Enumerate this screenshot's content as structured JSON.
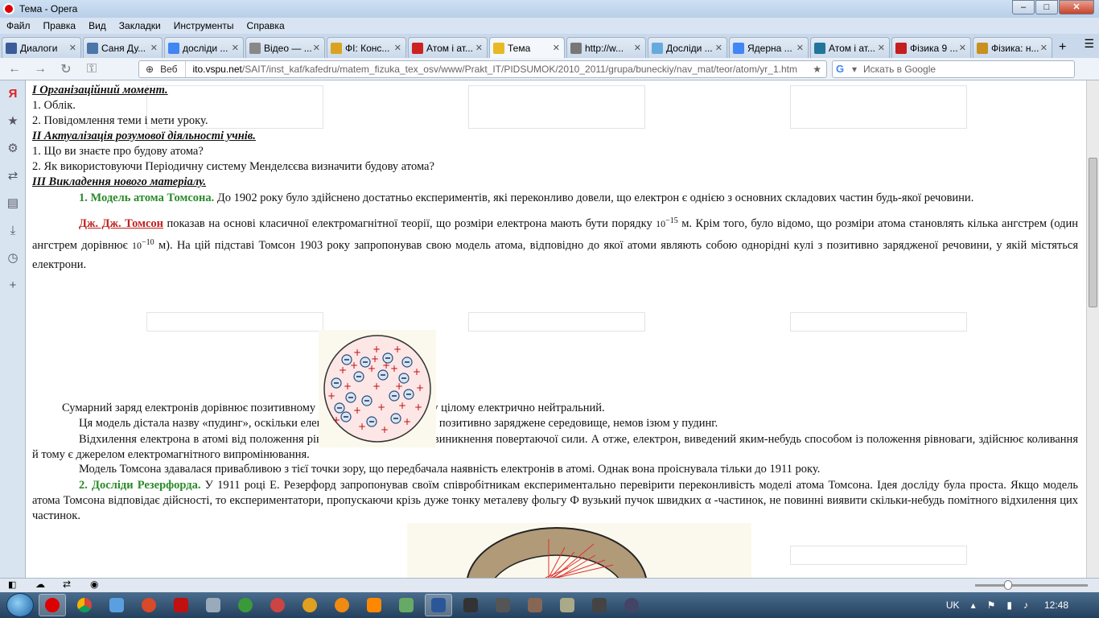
{
  "window": {
    "title": "Тема - Opera"
  },
  "menu": [
    "Файл",
    "Правка",
    "Вид",
    "Закладки",
    "Инструменты",
    "Справка"
  ],
  "tabs": [
    {
      "label": "Диалоги",
      "color": "#3b5b99"
    },
    {
      "label": "Саня Ду...",
      "color": "#4a76a8"
    },
    {
      "label": "досліди ...",
      "color": "#4285f4"
    },
    {
      "label": "Відео — ...",
      "color": "#888888"
    },
    {
      "label": "ФІ: Конс...",
      "color": "#d9a321"
    },
    {
      "label": "Атом і ат...",
      "color": "#cc2222"
    },
    {
      "label": "Тема",
      "color": "#e8b923",
      "active": true
    },
    {
      "label": "http://w...",
      "color": "#777777"
    },
    {
      "label": "Досліди ...",
      "color": "#66aadd"
    },
    {
      "label": "Ядерна ...",
      "color": "#4285f4"
    },
    {
      "label": "Атом і ат...",
      "color": "#21759b"
    },
    {
      "label": "Фізика 9 ...",
      "color": "#c41e1e"
    },
    {
      "label": "Фізика: н...",
      "color": "#c8901e"
    }
  ],
  "address": {
    "web_label": "Веб",
    "domain": "ito.vspu.net",
    "path": "/SAIT/inst_kaf/kafedru/matem_fizuka_tex_osv/www/Prakt_IT/PIDSUMOK/2010_2011/grupa/buneckiy/nav_mat/teor/atom/yr_1.htm",
    "search_placeholder": "Искать в Google"
  },
  "content": {
    "h1": "I Організаційний момент.",
    "l1": "1. Облік.",
    "l2": "2. Повідомлення теми і мети уроку.",
    "h2": "II Актуалізація розумової діяльності учнів.",
    "l3": "1. Що ви знаєте про будову атома?",
    "l4": "2. Як використовуючи Періодичну систему Менделєєва  визначити будову атома?",
    "h3": "III Викладення нового матеріалу.",
    "p1_title": "1. Модель атома Томсона.",
    "p1_text": " До 1902 року було здійснено достатньо експериментів, які переконливо довели, що електрон є однією з основних складових частин будь-якої речовини.",
    "p2_link": "Дж. Дж. Томсон",
    "p2_a": " показав на основі класичної електромагнітної теорії, що розміри електрона мають бути порядку ",
    "p2_exp1": "10",
    "p2_sup1": "−15",
    "p2_b": " м. Крім того, було відомо, що розміри атома становлять кілька ангстрем (один ангстрем дорівнює ",
    "p2_exp2": "10",
    "p2_sup2": "−10",
    "p2_c": " м). На цій підставі Томсон 1903 року запропонував свою модель атома, відповідно до якої атоми являють собою однорідні кулі з позитивно зарядженої речовини, у якій містяться електрони.",
    "p3": "Сумарний заряд електронів дорівнює позитивному заряду кулі, тому атом у цілому електрично нейтральний.",
    "p4": "Ця модель дістала назву «пудинг», оскільки електрони ніби вкраплені в позитивно заряджене середовище, немов ізюм у пудинг.",
    "p5": "Відхилення електрона в атомі від положення рівноваги призводить до виникнення повертаючої сили. А отже, електрон, виведений яким-небудь способом із положення рівноваги, здійснює коливання й тому є джерелом електромагнітного випромінювання.",
    "p6": "Модель Томсона здавалася привабливою з тієї точки зору, що передбачала наявність електронів в атомі. Однак вона проіснувала тільки до 1911 року.",
    "p7_title": "2. Досліди Резерфорда.",
    "p7_text": " У 1911 році Е. Резерфорд запропонував своїм співробітникам експериментально перевірити переконливість моделі атома Томсона. Ідея досліду була проста. Якщо модель атома Томсона відповідає дійсності, то експериментатори, пропускаючи крізь дуже тонку металеву фольгу Ф вузький пучок швидких α -частинок, не повинні виявити скільки-небудь помітного відхилення цих частинок."
  },
  "taskbar": {
    "lang": "UK",
    "time": "12:48"
  }
}
